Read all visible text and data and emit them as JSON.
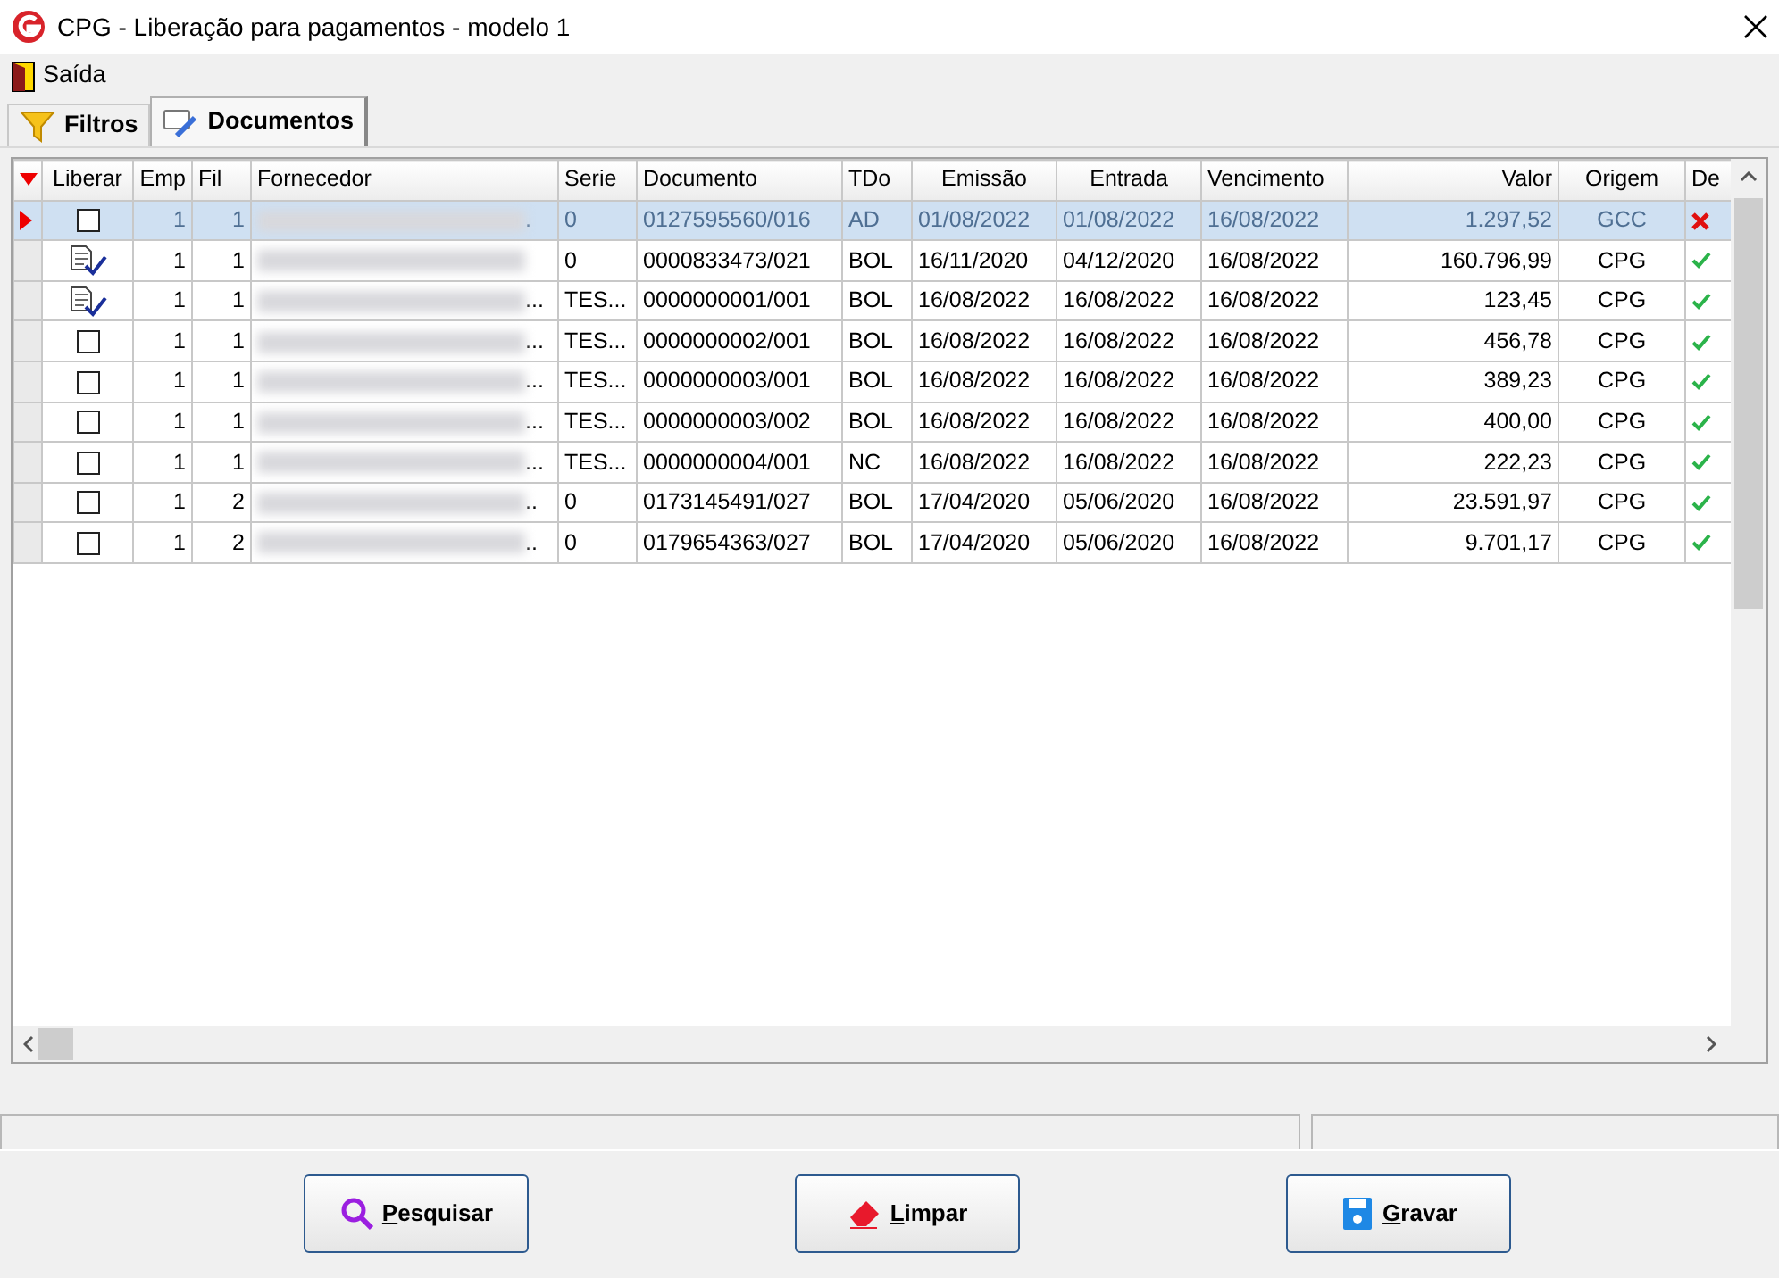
{
  "window": {
    "title": "CPG - Liberação para pagamentos - modelo 1"
  },
  "menu": [
    {
      "label": "Saída"
    }
  ],
  "tabs": [
    {
      "label": "Filtros",
      "selected": false
    },
    {
      "label": "Documentos",
      "selected": true
    }
  ],
  "table": {
    "columns": [
      "Liberar",
      "Emp",
      "Fil",
      "Fornecedor",
      "Serie",
      "Documento",
      "TDo",
      "Emissão",
      "Entrada",
      "Vencimento",
      "Valor",
      "Origem",
      "De"
    ],
    "rows": [
      {
        "selected": true,
        "released": false,
        "emp": "1",
        "fil": "1",
        "fornecedor": ".",
        "serie": "0",
        "documento": "0127595560/016",
        "tdo": "AD",
        "emissao": "01/08/2022",
        "entrada": "01/08/2022",
        "vencimento": "16/08/2022",
        "valor": "1.297,52",
        "origem": "GCC",
        "ok": false
      },
      {
        "selected": false,
        "released": true,
        "emp": "1",
        "fil": "1",
        "serie": "0",
        "documento": "0000833473/021",
        "tdo": "BOL",
        "emissao": "16/11/2020",
        "entrada": "04/12/2020",
        "vencimento": "16/08/2022",
        "valor": "160.796,99",
        "origem": "CPG",
        "ok": true
      },
      {
        "selected": false,
        "released": true,
        "emp": "1",
        "fil": "1",
        "fornecedor": "...",
        "serie": "TES...",
        "documento": "0000000001/001",
        "tdo": "BOL",
        "emissao": "16/08/2022",
        "entrada": "16/08/2022",
        "vencimento": "16/08/2022",
        "valor": "123,45",
        "origem": "CPG",
        "ok": true
      },
      {
        "selected": false,
        "released": false,
        "emp": "1",
        "fil": "1",
        "fornecedor": "...",
        "serie": "TES...",
        "documento": "0000000002/001",
        "tdo": "BOL",
        "emissao": "16/08/2022",
        "entrada": "16/08/2022",
        "vencimento": "16/08/2022",
        "valor": "456,78",
        "origem": "CPG",
        "ok": true
      },
      {
        "selected": false,
        "released": false,
        "emp": "1",
        "fil": "1",
        "fornecedor": "...",
        "serie": "TES...",
        "documento": "0000000003/001",
        "tdo": "BOL",
        "emissao": "16/08/2022",
        "entrada": "16/08/2022",
        "vencimento": "16/08/2022",
        "valor": "389,23",
        "origem": "CPG",
        "ok": true
      },
      {
        "selected": false,
        "released": false,
        "emp": "1",
        "fil": "1",
        "fornecedor": "...",
        "serie": "TES...",
        "documento": "0000000003/002",
        "tdo": "BOL",
        "emissao": "16/08/2022",
        "entrada": "16/08/2022",
        "vencimento": "16/08/2022",
        "valor": "400,00",
        "origem": "CPG",
        "ok": true
      },
      {
        "selected": false,
        "released": false,
        "emp": "1",
        "fil": "1",
        "fornecedor": "...",
        "serie": "TES...",
        "documento": "0000000004/001",
        "tdo": "NC",
        "emissao": "16/08/2022",
        "entrada": "16/08/2022",
        "vencimento": "16/08/2022",
        "valor": "222,23",
        "origem": "CPG",
        "ok": true
      },
      {
        "selected": false,
        "released": false,
        "emp": "1",
        "fil": "2",
        "fornecedor": "..",
        "serie": "0",
        "documento": "0173145491/027",
        "tdo": "BOL",
        "emissao": "17/04/2020",
        "entrada": "05/06/2020",
        "vencimento": "16/08/2022",
        "valor": "23.591,97",
        "origem": "CPG",
        "ok": true
      },
      {
        "selected": false,
        "released": false,
        "emp": "1",
        "fil": "2",
        "fornecedor": "..",
        "serie": "0",
        "documento": "0179654363/027",
        "tdo": "BOL",
        "emissao": "17/04/2020",
        "entrada": "05/06/2020",
        "vencimento": "16/08/2022",
        "valor": "9.701,17",
        "origem": "CPG",
        "ok": true
      }
    ]
  },
  "buttons": [
    {
      "kind": "search",
      "label": "Pesquisar"
    },
    {
      "kind": "clear",
      "label": "Limpar"
    },
    {
      "kind": "save",
      "label": "Gravar"
    }
  ]
}
